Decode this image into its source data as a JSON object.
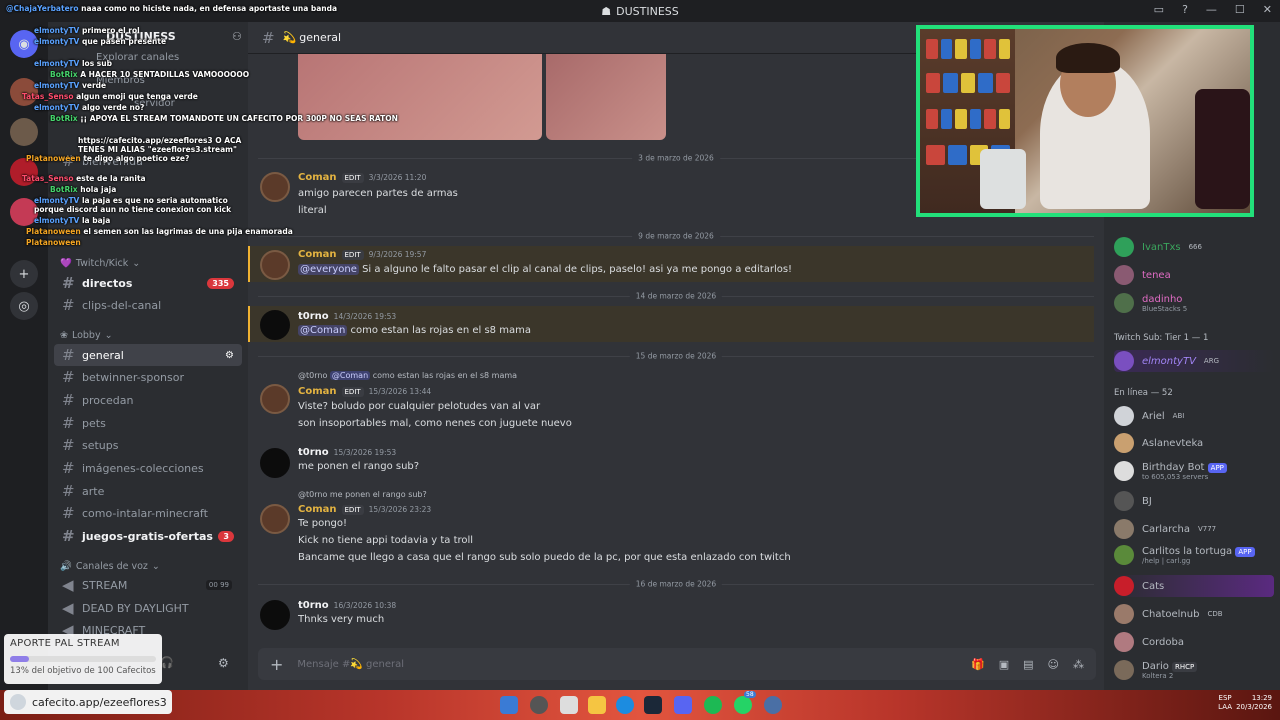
{
  "titlebar": {
    "title": "DUSTINESS"
  },
  "server": {
    "name": "DUSTINESS",
    "browse_channels": "Explorar canales",
    "members": "Miembros",
    "server_boost": "servidor"
  },
  "sidebar": {
    "channel_welcome": "bienvenida",
    "cat_twitch": "Twitch/Kick",
    "cat_lobby": "Lobby",
    "cat_voice": "Canales de voz",
    "channels": [
      {
        "name": "directos",
        "badge": "335"
      },
      {
        "name": "clips-del-canal",
        "badge": ""
      },
      {
        "name": "general",
        "badge": ""
      },
      {
        "name": "betwinner-sponsor",
        "badge": ""
      },
      {
        "name": "procedan",
        "badge": ""
      },
      {
        "name": "pets",
        "badge": ""
      },
      {
        "name": "setups",
        "badge": ""
      },
      {
        "name": "imágenes-colecciones",
        "badge": ""
      },
      {
        "name": "arte",
        "badge": ""
      },
      {
        "name": "como-intalar-minecraft",
        "badge": ""
      },
      {
        "name": "juegos-gratis-ofertas",
        "badge": "3"
      }
    ],
    "voice": [
      {
        "name": "STREAM",
        "count_a": "00",
        "count_b": "99"
      },
      {
        "name": "DEAD BY DAYLIGHT"
      },
      {
        "name": "MINECRAFT"
      }
    ]
  },
  "chat": {
    "channel": "general",
    "placeholder": "Mensaje #💫 general",
    "dividers": [
      "3 de marzo de 2026",
      "9 de marzo de 2026",
      "14 de marzo de 2026",
      "15 de marzo de 2026",
      "16 de marzo de 2026"
    ],
    "messages": [
      {
        "user": "Coman",
        "tag": "EDIT",
        "time": "3/3/2026 11:20",
        "lines": [
          "amigo parecen partes de armas",
          "literal"
        ]
      },
      {
        "user": "Coman",
        "tag": "EDIT",
        "time": "9/3/2026 19:57",
        "mention": "@everyone",
        "lines": [
          "Si a alguno le falto pasar el clip al canal de clips, paselo! asi ya me pongo a editarlos!"
        ]
      },
      {
        "user": "t0rno",
        "time": "14/3/2026 19:53",
        "mention": "@Coman",
        "lines": [
          "como estan las rojas en el s8 mama"
        ]
      },
      {
        "user": "Coman",
        "tag": "EDIT",
        "time": "15/3/2026 13:44",
        "reply_user": "@t0rno",
        "reply_mention": "@Coman",
        "reply_text": "como estan las rojas en el s8 mama",
        "lines": [
          "Viste? boludo por cualquier pelotudes van al var",
          "son insoportables mal, como nenes con juguete nuevo"
        ]
      },
      {
        "user": "t0rno",
        "time": "15/3/2026 19:53",
        "lines": [
          "me ponen el rango sub?"
        ]
      },
      {
        "user": "Coman",
        "tag": "EDIT",
        "time": "15/3/2026 23:23",
        "reply_user": "@t0rno",
        "reply_text": "me ponen el rango sub?",
        "lines": [
          "Te pongo!",
          "Kick no tiene appi todavia y ta troll",
          "Bancame que llego a casa que el rango sub solo puedo de la pc, por que esta enlazado con twitch"
        ]
      },
      {
        "user": "t0rno",
        "time": "16/3/2026 10:38",
        "lines": [
          "Thnks very much"
        ]
      }
    ]
  },
  "members": {
    "list_top": [
      {
        "name": "IvanTxs",
        "sub": "666"
      },
      {
        "name": "tenea",
        "sub": ""
      },
      {
        "name": "dadinho",
        "sub": "BlueStacks 5"
      }
    ],
    "section_twitch": "Twitch Sub: Tier 1 — 1",
    "twitch_member": {
      "name": "elmontyTV",
      "sub": "ARG"
    },
    "section_online": "En línea — 52",
    "online": [
      {
        "name": "Ariel",
        "sub": "ABI"
      },
      {
        "name": "Aslanevteka",
        "sub": ""
      },
      {
        "name": "Birthday Bot",
        "sub": "to 605,053 servers",
        "badge": "APP"
      },
      {
        "name": "BJ",
        "sub": ""
      },
      {
        "name": "Carlarcha",
        "sub": "V777"
      },
      {
        "name": "Carlitos la tortuga",
        "sub": "/help | carl.gg",
        "badge": "APP"
      },
      {
        "name": "Cats",
        "sub": ""
      },
      {
        "name": "Chatoelnub",
        "sub": "CDB"
      },
      {
        "name": "Cordoba",
        "sub": ""
      },
      {
        "name": "Dario",
        "sub": "Koltera 2",
        "badge": "RHCP"
      }
    ]
  },
  "streamchat": [
    {
      "user": "@ChajaYerbatero",
      "text": "naaa como no hiciste nada, en defensa aportaste una banda"
    },
    {
      "user": "elmontyTV",
      "text": "primero el rol"
    },
    {
      "user": "elmontyTV",
      "text": "que pasen presente"
    },
    {
      "user": "elmontyTV",
      "text": "los sub"
    },
    {
      "user": "BotRix",
      "text": "A HACER 10 SENTADILLAS VAMOOOOOO"
    },
    {
      "user": "elmontyTV",
      "text": "verde"
    },
    {
      "user": "Tatas_Senso",
      "text": "algun emoji que tenga verde"
    },
    {
      "user": "elmontyTV",
      "text": "algo verde no?"
    },
    {
      "user": "BotRix",
      "text": "¡¡ APOYA EL STREAM TOMANDOTE UN CAFECITO POR 300P NO SEAS RATON"
    },
    {
      "user": "",
      "text": "https://cafecito.app/ezeeflores3 O ACA TENES MI ALIAS \"ezeeflores3.stream\""
    },
    {
      "user": "Platanoween",
      "text": "te digo algo poetico eze?"
    },
    {
      "user": "Tatas_Senso",
      "text": "este de la ranita"
    },
    {
      "user": "BotRix",
      "text": "hola jaja"
    },
    {
      "user": "elmontyTV",
      "text": "la paja es que no seria automatico porque discord aun no tiene conexion con kick"
    },
    {
      "user": "elmontyTV",
      "text": "la baja"
    },
    {
      "user": "Platanoween",
      "text": "el semen son las lagrimas de una pija enamorada"
    },
    {
      "user": "Platanoween",
      "text": ""
    }
  ],
  "donation": {
    "title": "APORTE PAL STREAM",
    "progress": 0.13,
    "status": "13% del objetivo de 100 Cafecitos"
  },
  "cafelink": "cafecito.app/ezeeflores3",
  "taskbar": {
    "lang_a": "ESP",
    "lang_b": "LAA",
    "time": "13:29",
    "date": "20/3/2026",
    "notif_badge": "58"
  }
}
